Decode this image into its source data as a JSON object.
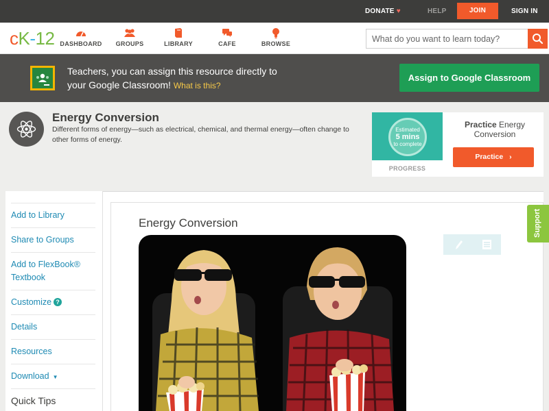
{
  "topbar": {
    "donate": "DONATE",
    "help": "HELP",
    "join": "JOIN",
    "signin": "SIGN IN"
  },
  "header": {
    "logo": {
      "c": "c",
      "k": "K",
      "dash": "-",
      "num": "12"
    },
    "nav": [
      {
        "label": "DASHBOARD",
        "icon": "dashboard-gauge-icon"
      },
      {
        "label": "GROUPS",
        "icon": "groups-people-icon"
      },
      {
        "label": "LIBRARY",
        "icon": "library-book-icon"
      },
      {
        "label": "CAFE",
        "icon": "cafe-chat-icon"
      },
      {
        "label": "BROWSE",
        "icon": "browse-lightbulb-icon"
      }
    ],
    "search_placeholder": "What do you want to learn today?"
  },
  "banner": {
    "line1": "Teachers, you can assign this resource directly to",
    "line2": "your Google Classroom!",
    "link": "What is this?",
    "assign_button": "Assign to Google Classroom"
  },
  "concept": {
    "title": "Energy Conversion",
    "description": "Different forms of energy—such as electrical, chemical, and thermal energy—often change to other forms of energy."
  },
  "practice": {
    "estimated_top": "Estimated",
    "estimated_mins": "5 mins",
    "estimated_bottom": "to complete",
    "progress_label": "PROGRESS",
    "title_bold": "Practice",
    "title_rest": " Energy Conversion",
    "button": "Practice"
  },
  "sidebar": {
    "items": [
      "Add to Library",
      "Share to Groups",
      "Add to FlexBook® Textbook",
      "Customize",
      "Details",
      "Resources",
      "Download",
      "Quick Tips"
    ],
    "customize_help": "?"
  },
  "article": {
    "title": "Energy Conversion"
  },
  "support": "Support",
  "colors": {
    "brand_orange": "#f15a2b",
    "brand_green": "#77b944",
    "assign_green": "#1e9e55",
    "link_blue": "#1e8ab3",
    "support_green": "#8cc63f"
  }
}
